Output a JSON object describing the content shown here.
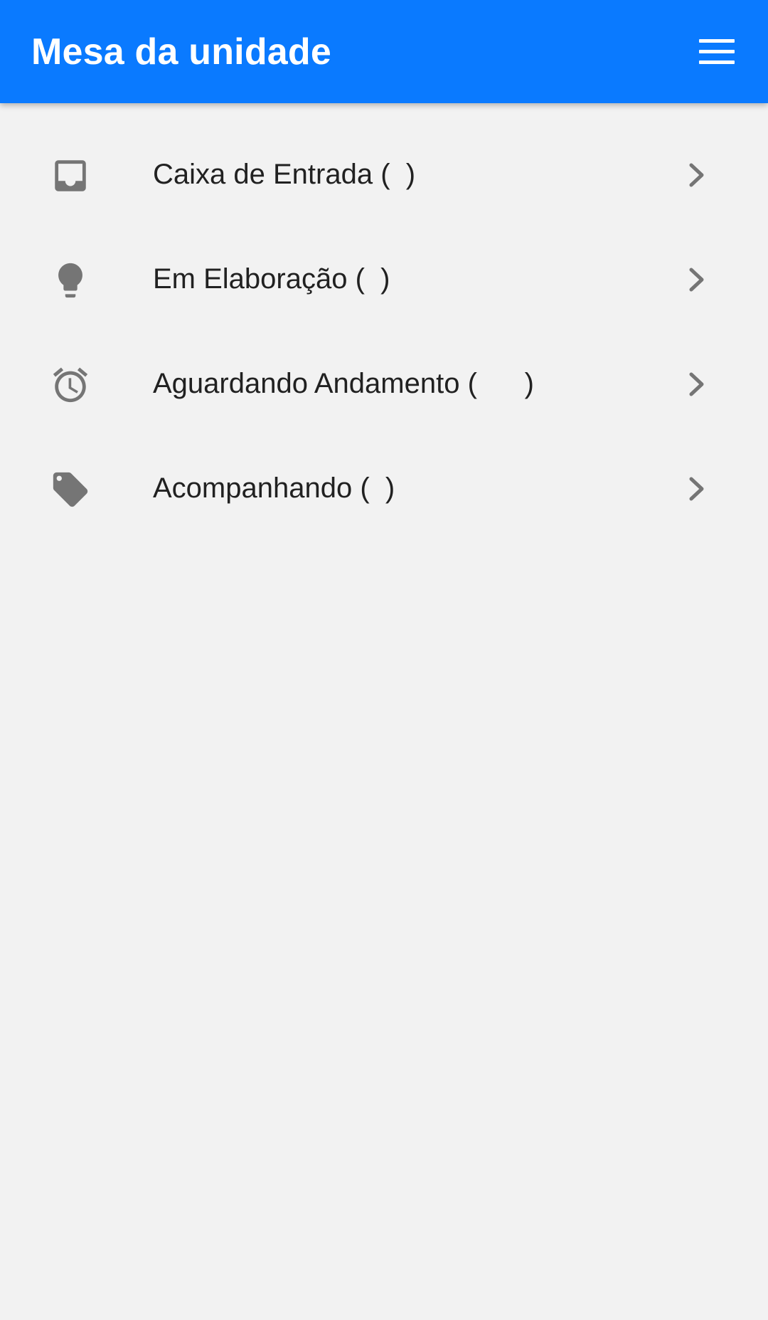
{
  "header": {
    "title": "Mesa da unidade",
    "menu_icon": "hamburger-menu-icon"
  },
  "colors": {
    "app_bar": "#0a7aff",
    "background": "#f2f2f2",
    "icon": "#757575",
    "text": "#212121"
  },
  "menu": {
    "items": [
      {
        "label": "Caixa de Entrada (  )",
        "icon": "inbox-icon"
      },
      {
        "label": "Em Elaboração (  )",
        "icon": "lightbulb-icon"
      },
      {
        "label": "Aguardando Andamento (      )",
        "icon": "alarm-clock-icon"
      },
      {
        "label": "Acompanhando (  )",
        "icon": "tag-icon"
      }
    ]
  }
}
